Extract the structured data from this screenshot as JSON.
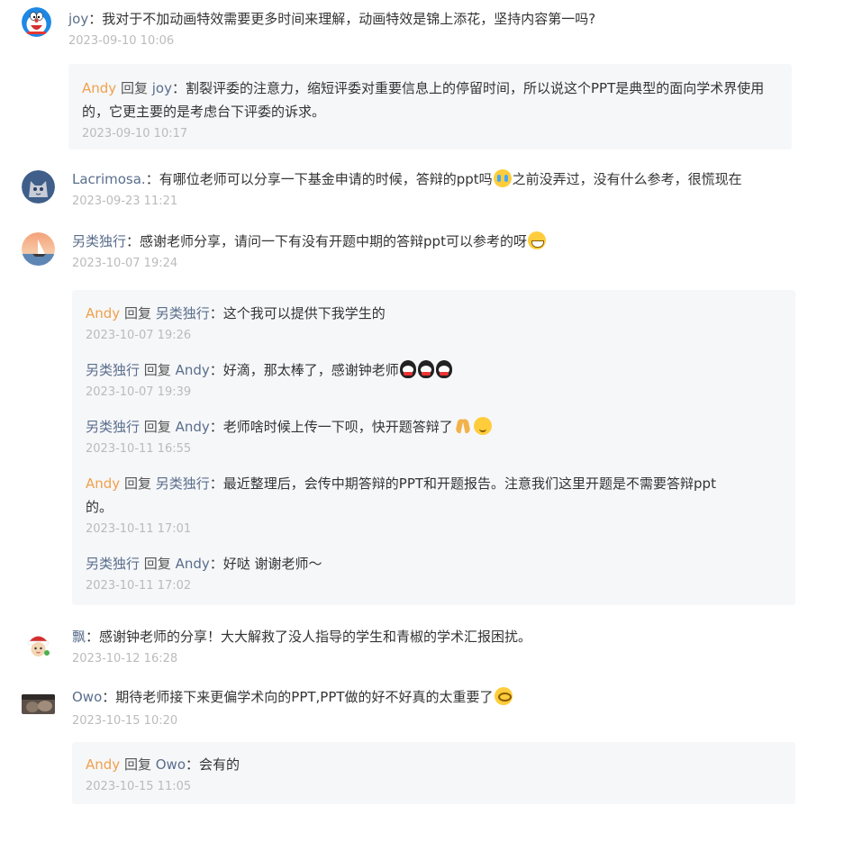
{
  "labels": {
    "reply_kw": "回复",
    "sep": "："
  },
  "comments": [
    {
      "user": "joy",
      "text": "我对于不加动画特效需要更多时间来理解，动画特效是锦上添花，坚持内容第一吗?",
      "time": "2023-09-10 10:06",
      "avatar": "doraemon-avatar",
      "replies": [
        {
          "from": "Andy",
          "to": "joy",
          "text": "割裂评委的注意力，缩短评委对重要信息上的停留时间，所以说这个PPT是典型的面向学术界使用的，它更主要的是考虑台下评委的诉求。",
          "time": "2023-09-10 10:17"
        }
      ]
    },
    {
      "user": "Lacrimosa.",
      "text_a": "有哪位老师可以分享一下基金申请的时候，答辩的ppt吗",
      "emoji": "loudly-crying-emoji",
      "text_b": "之前没弄过，没有什么参考，很慌现在",
      "time": "2023-09-23 11:21",
      "avatar": "cat-avatar"
    },
    {
      "user": "另类独行",
      "text": "感谢老师分享，请问一下有没有开题中期的答辩ppt可以参考的呀",
      "emoji": "grinning-emoji",
      "time": "2023-10-07 19:24",
      "avatar": "sunset-boat-avatar",
      "replies": [
        {
          "from": "Andy",
          "to": "另类独行",
          "text": "这个我可以提供下我学生的",
          "time": "2023-10-07 19:26"
        },
        {
          "from": "另类独行",
          "to": "Andy",
          "text": "好滴，那太棒了，感谢钟老师",
          "emoji": "qq-penguin-emoji",
          "time": "2023-10-07 19:39"
        },
        {
          "from": "另类独行",
          "to": "Andy",
          "text": "老师啥时候上传一下呗，快开题答辩了",
          "emoji_a": "praying-hands-emoji",
          "emoji_b": "smiling-face-emoji",
          "time": "2023-10-11 16:55"
        },
        {
          "from": "Andy",
          "to": "另类独行",
          "text_a": "最近整理后，会传中期答辩的PPT和开题报告。注意我们这里开题是不需要答辩ppt",
          "text_b": "的。",
          "time": "2023-10-11 17:01"
        },
        {
          "from": "另类独行",
          "to": "Andy",
          "text": "好哒 谢谢老师～",
          "time": "2023-10-11 17:02"
        }
      ]
    },
    {
      "user": "飘",
      "text": "感谢钟老师的分享！大大解救了没人指导的学生和青椒的学术汇报困扰。",
      "time": "2023-10-12 16:28",
      "avatar": "christmas-girl-avatar"
    },
    {
      "user": "Owo",
      "text": "期待老师接下来更偏学术向的PPT,PPT做的好不好真的太重要了",
      "emoji": "dizzy-face-emoji",
      "time": "2023-10-15 10:20",
      "avatar": "photo-avatar",
      "replies": [
        {
          "from": "Andy",
          "to": "Owo",
          "text": "会有的",
          "time": "2023-10-15 11:05"
        }
      ]
    }
  ]
}
